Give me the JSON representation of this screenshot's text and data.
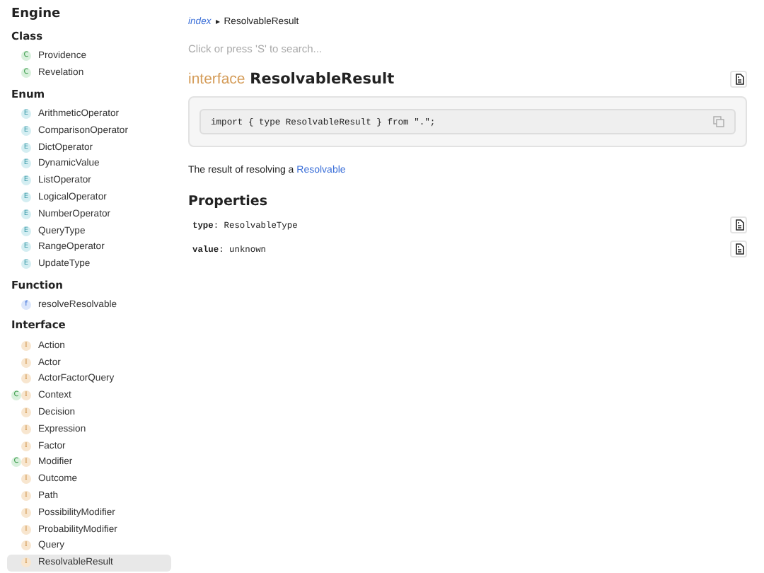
{
  "sidebar": {
    "title": "Engine",
    "groups": [
      {
        "heading": "Class",
        "items": [
          {
            "label": "Providence",
            "badges": [
              {
                "kind": "class",
                "text": "C"
              }
            ],
            "selected": false
          },
          {
            "label": "Revelation",
            "badges": [
              {
                "kind": "class",
                "text": "C"
              }
            ],
            "selected": false
          }
        ]
      },
      {
        "heading": "Enum",
        "items": [
          {
            "label": "ArithmeticOperator",
            "badges": [
              {
                "kind": "enum",
                "text": "E"
              }
            ],
            "selected": false
          },
          {
            "label": "ComparisonOperator",
            "badges": [
              {
                "kind": "enum",
                "text": "E"
              }
            ],
            "selected": false
          },
          {
            "label": "DictOperator",
            "badges": [
              {
                "kind": "enum",
                "text": "E"
              }
            ],
            "selected": false
          },
          {
            "label": "DynamicValue",
            "badges": [
              {
                "kind": "enum",
                "text": "E"
              }
            ],
            "selected": false
          },
          {
            "label": "ListOperator",
            "badges": [
              {
                "kind": "enum",
                "text": "E"
              }
            ],
            "selected": false
          },
          {
            "label": "LogicalOperator",
            "badges": [
              {
                "kind": "enum",
                "text": "E"
              }
            ],
            "selected": false
          },
          {
            "label": "NumberOperator",
            "badges": [
              {
                "kind": "enum",
                "text": "E"
              }
            ],
            "selected": false
          },
          {
            "label": "QueryType",
            "badges": [
              {
                "kind": "enum",
                "text": "E"
              }
            ],
            "selected": false
          },
          {
            "label": "RangeOperator",
            "badges": [
              {
                "kind": "enum",
                "text": "E"
              }
            ],
            "selected": false
          },
          {
            "label": "UpdateType",
            "badges": [
              {
                "kind": "enum",
                "text": "E"
              }
            ],
            "selected": false
          }
        ]
      },
      {
        "heading": "Function",
        "items": [
          {
            "label": "resolveResolvable",
            "badges": [
              {
                "kind": "function",
                "text": "f"
              }
            ],
            "selected": false
          }
        ]
      },
      {
        "heading": "Interface",
        "items": [
          {
            "label": "Action",
            "badges": [
              {
                "kind": "interface",
                "text": "I"
              }
            ],
            "selected": false
          },
          {
            "label": "Actor",
            "badges": [
              {
                "kind": "interface",
                "text": "I"
              }
            ],
            "selected": false
          },
          {
            "label": "ActorFactorQuery",
            "badges": [
              {
                "kind": "interface",
                "text": "I"
              }
            ],
            "selected": false
          },
          {
            "label": "Context",
            "badges": [
              {
                "kind": "class",
                "text": "C"
              },
              {
                "kind": "interface",
                "text": "I"
              }
            ],
            "selected": false
          },
          {
            "label": "Decision",
            "badges": [
              {
                "kind": "interface",
                "text": "I"
              }
            ],
            "selected": false
          },
          {
            "label": "Expression",
            "badges": [
              {
                "kind": "interface",
                "text": "I"
              }
            ],
            "selected": false
          },
          {
            "label": "Factor",
            "badges": [
              {
                "kind": "interface",
                "text": "I"
              }
            ],
            "selected": false
          },
          {
            "label": "Modifier",
            "badges": [
              {
                "kind": "class",
                "text": "C"
              },
              {
                "kind": "interface",
                "text": "I"
              }
            ],
            "selected": false
          },
          {
            "label": "Outcome",
            "badges": [
              {
                "kind": "interface",
                "text": "I"
              }
            ],
            "selected": false
          },
          {
            "label": "Path",
            "badges": [
              {
                "kind": "interface",
                "text": "I"
              }
            ],
            "selected": false
          },
          {
            "label": "PossibilityModifier",
            "badges": [
              {
                "kind": "interface",
                "text": "I"
              }
            ],
            "selected": false
          },
          {
            "label": "ProbabilityModifier",
            "badges": [
              {
                "kind": "interface",
                "text": "I"
              }
            ],
            "selected": false
          },
          {
            "label": "Query",
            "badges": [
              {
                "kind": "interface",
                "text": "I"
              }
            ],
            "selected": false
          },
          {
            "label": "ResolvableResult",
            "badges": [
              {
                "kind": "interface",
                "text": "I"
              }
            ],
            "selected": true
          }
        ]
      }
    ]
  },
  "breadcrumb": {
    "link": "index",
    "separator": "▸",
    "current": "ResolvableResult"
  },
  "search": {
    "placeholder": "Click or press 'S' to search..."
  },
  "heading": {
    "keyword": "interface",
    "name": "ResolvableResult"
  },
  "code": "import { type ResolvableResult } from \".\";",
  "description": {
    "text": "The result of resolving a",
    "link": "Resolvable"
  },
  "properties": {
    "title": "Properties",
    "items": [
      {
        "name": "type",
        "sep": ":",
        "type": "ResolvableType"
      },
      {
        "name": "value",
        "sep": ":",
        "type": "unknown"
      }
    ]
  }
}
